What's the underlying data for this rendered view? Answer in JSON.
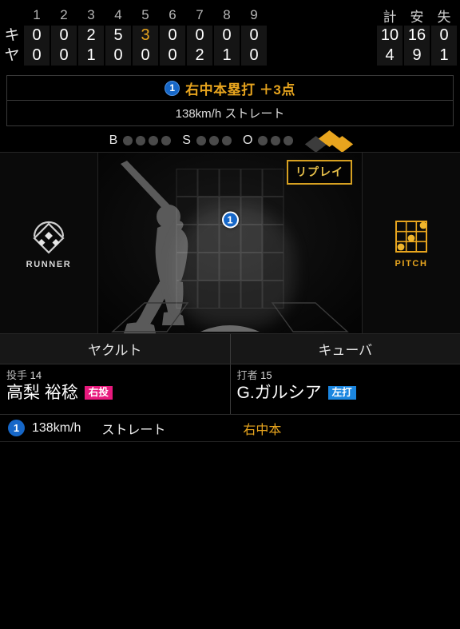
{
  "scoreboard": {
    "innings": [
      "1",
      "2",
      "3",
      "4",
      "5",
      "6",
      "7",
      "8",
      "9"
    ],
    "total_headers": [
      "計",
      "安",
      "失"
    ],
    "current_inning_index": 4,
    "rows": [
      {
        "abbr": "キ",
        "scores": [
          "0",
          "0",
          "2",
          "5",
          "3",
          "0",
          "0",
          "0",
          "0"
        ],
        "totals": [
          "10",
          "16",
          "0"
        ]
      },
      {
        "abbr": "ヤ",
        "scores": [
          "0",
          "0",
          "1",
          "0",
          "0",
          "0",
          "2",
          "1",
          "0"
        ],
        "totals": [
          "4",
          "9",
          "1"
        ]
      }
    ]
  },
  "banner": {
    "pitch_number": "1",
    "event_text": "右中本塁打 ＋3点",
    "pitch_detail": "138km/h ストレート"
  },
  "count": {
    "ball_label": "B",
    "strike_label": "S",
    "out_label": "O",
    "balls": 0,
    "balls_max": 4,
    "strikes": 0,
    "strikes_max": 3,
    "outs": 0,
    "outs_max": 3,
    "bases": {
      "first": true,
      "second": true,
      "third": false
    }
  },
  "viewer": {
    "runner_label": "RUNNER",
    "pitch_label": "PITCH",
    "replay_label": "リプレイ",
    "pitch_marker": "1"
  },
  "teams": {
    "left": "ヤクルト",
    "right": "キューバ"
  },
  "players": {
    "pitcher": {
      "role": "投手",
      "number": "14",
      "name": "高梨 裕稔",
      "badge": "右投"
    },
    "batter": {
      "role": "打者",
      "number": "15",
      "name": "G.ガルシア",
      "badge": "左打"
    }
  },
  "pitch_log": {
    "number": "1",
    "speed": "138km/h",
    "type": "ストレート",
    "result": "右中本"
  },
  "colors": {
    "accent_gold": "#e8a51e",
    "pitch_blue": "#1667c8",
    "badge_pink": "#e8197d",
    "badge_blue": "#1b86e0"
  }
}
